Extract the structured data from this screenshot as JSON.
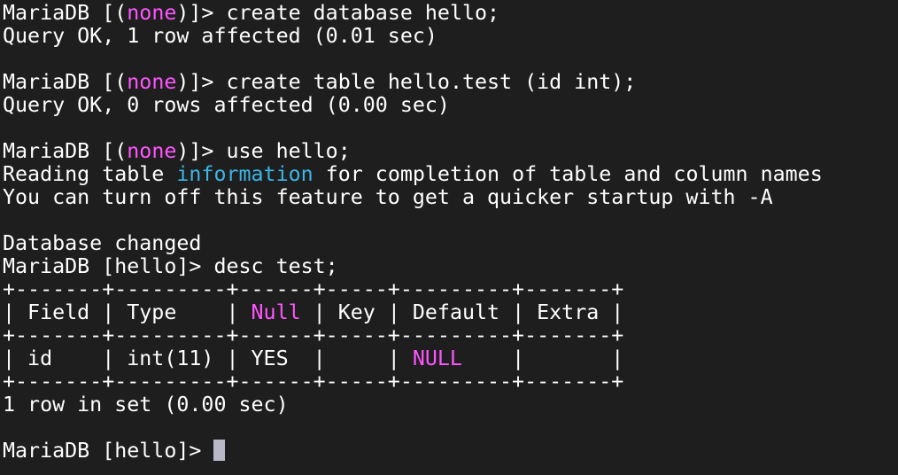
{
  "colors": {
    "background": "#1e1e1e",
    "text": "#ffffff",
    "highlight_magenta": "#ff55ff",
    "highlight_cyan": "#3bb6e6",
    "cursor": "#b8b8c8"
  },
  "lines": {
    "l1": {
      "p1": "MariaDB [(",
      "hl": "none",
      "p2": ")]> create database hello;"
    },
    "l2": "Query OK, 1 row affected (0.01 sec)",
    "l4": {
      "p1": "MariaDB [(",
      "hl": "none",
      "p2": ")]> create table hello.test (id int);"
    },
    "l5": "Query OK, 0 rows affected (0.00 sec)",
    "l7": {
      "p1": "MariaDB [(",
      "hl": "none",
      "p2": ")]> use hello;"
    },
    "l8": {
      "p1": "Reading table ",
      "hl": "information",
      "p2": " for completion of table and column names"
    },
    "l9": "You can turn off this feature to get a quicker startup with -A",
    "l11": "Database changed",
    "l12": "MariaDB [hello]> desc test;",
    "l13": "+-------+---------+------+-----+---------+-------+",
    "l14": {
      "p1": "| Field | Type    | ",
      "hl": "Null",
      "p2": " | Key | Default | Extra |"
    },
    "l15": "+-------+---------+------+-----+---------+-------+",
    "l16": {
      "p1": "| id    | int(11) | YES  |     | ",
      "hl": "NULL",
      "p2": "    |       |"
    },
    "l17": "+-------+---------+------+-----+---------+-------+",
    "l18": "1 row in set (0.00 sec)",
    "l20": "MariaDB [hello]> "
  }
}
